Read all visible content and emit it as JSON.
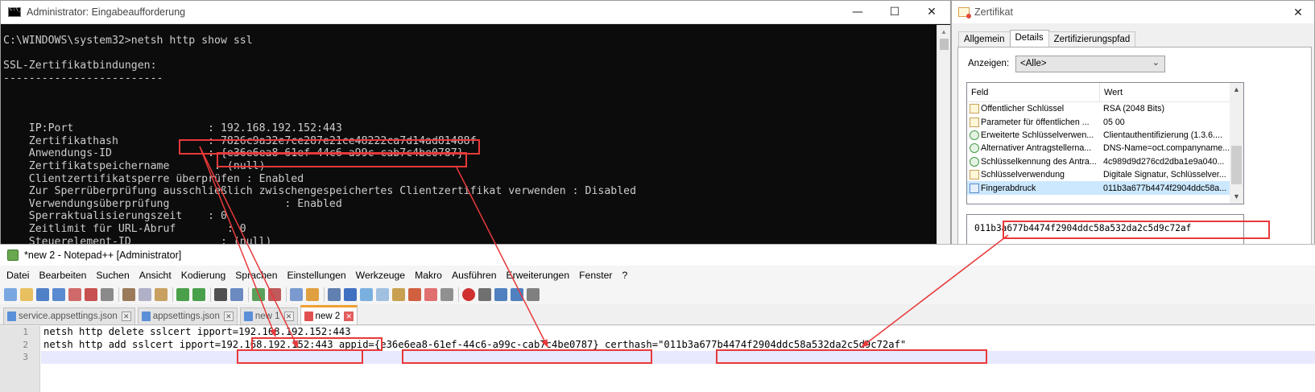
{
  "cmd": {
    "title": "Administrator: Eingabeaufforderung",
    "controls": {
      "minimize": "—",
      "maximize": "☐",
      "close": "✕"
    },
    "lines": [
      "C:\\WINDOWS\\system32>netsh http show ssl",
      "",
      "SSL-Zertifikatbindungen:",
      "-------------------------",
      "",
      "",
      "",
      "    IP:Port                     : 192.168.192.152:443",
      "    Zertifikathash              : 7826c9a32e7ce287e21ce48222ca7d14ad81488f",
      "    Anwendungs-ID               : {e36e6ea8-61ef-44c6-a99c-cab7c4be0787}",
      "    Zertifikatspeichername       : (null)",
      "    Clientzertifikatsperre überprüfen : Enabled",
      "    Zur Sperrüberprüfung ausschließlich zwischengespeichertes Clientzertifikat verwenden : Disabled",
      "    Verwendungsüberprüfung                  : Enabled",
      "    Sperraktualisierungszeit    : 0",
      "    Zeitlimit für URL-Abruf        : 0",
      "    Steuerelement-ID              : (null)"
    ]
  },
  "certificate": {
    "title": "Zertifikat",
    "close": "✕",
    "tabs": [
      "Allgemein",
      "Details",
      "Zertifizierungspfad"
    ],
    "active_tab": "Details",
    "show_label": "Anzeigen:",
    "show_value": "<Alle>",
    "columns": {
      "field": "Feld",
      "value": "Wert"
    },
    "rows": [
      {
        "field": "Öffentlicher Schlüssel",
        "value": "RSA (2048 Bits)",
        "icon": "certificate-field-icon"
      },
      {
        "field": "Parameter für öffentlichen ...",
        "value": "05 00",
        "icon": "certificate-field-icon"
      },
      {
        "field": "Erweiterte Schlüsselverwen...",
        "value": "Clientauthentifizierung (1.3.6....",
        "icon": "extension-icon"
      },
      {
        "field": "Alternativer Antragstellerna...",
        "value": "DNS-Name=oct.companyname....",
        "icon": "extension-icon"
      },
      {
        "field": "Schlüsselkennung des Antra...",
        "value": "4c989d9d276cd2dba1e9a040...",
        "icon": "extension-icon"
      },
      {
        "field": "Schlüsselverwendung",
        "value": "Digitale Signatur, Schlüsselver...",
        "icon": "warning-extension-icon"
      },
      {
        "field": "Fingerabdruck",
        "value": "011b3a677b4474f2904ddc58a...",
        "icon": "fingerprint-icon"
      }
    ],
    "selected_row": 6,
    "detail_value": "011b3a677b4474f2904ddc58a532da2c5d9c72af"
  },
  "notepad": {
    "title": "*new 2 - Notepad++ [Administrator]",
    "menu": [
      "Datei",
      "Bearbeiten",
      "Suchen",
      "Ansicht",
      "Kodierung",
      "Sprachen",
      "Einstellungen",
      "Werkzeuge",
      "Makro",
      "Ausführen",
      "Erweiterungen",
      "Fenster",
      "?"
    ],
    "file_tabs": [
      {
        "label": "service.appsettings.json",
        "active": false
      },
      {
        "label": "appsettings.json",
        "active": false
      },
      {
        "label": "new 1",
        "active": false
      },
      {
        "label": "new 2",
        "active": true
      }
    ],
    "line_numbers": [
      "1",
      "2",
      "3"
    ],
    "code_lines": [
      "netsh http delete sslcert ipport=192.168.192.152:443",
      "netsh http add sslcert ipport=192.168.192.152:443 appid={e36e6ea8-61ef-44c6-a99c-cab7c4be0787} certhash=\"011b3a677b4474f2904ddc58a532da2c5d9c72af\"",
      ""
    ]
  },
  "annotation_color": "#e8393a"
}
